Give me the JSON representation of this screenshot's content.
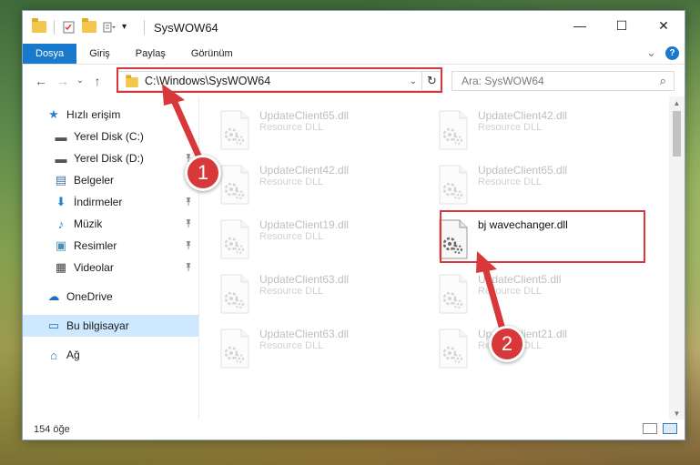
{
  "window": {
    "title": "SysWOW64",
    "controls": {
      "minimize": "—",
      "maximize": "☐",
      "close": "✕"
    }
  },
  "ribbon": {
    "tabs": [
      {
        "label": "Dosya",
        "active": true
      },
      {
        "label": "Giriş"
      },
      {
        "label": "Paylaş"
      },
      {
        "label": "Görünüm"
      }
    ],
    "expand": "⌄",
    "help": "?"
  },
  "navigation": {
    "back": "←",
    "forward": "→",
    "recent": "⌄",
    "up": "↑",
    "address": "C:\\Windows\\SysWOW64",
    "address_dropdown": "⌄",
    "refresh": "↻",
    "search_placeholder": "Ara: SysWOW64"
  },
  "sidebar": {
    "items": [
      {
        "label": "Hızlı erişim",
        "icon": "star-icon",
        "glyph": "★",
        "color": "#2a7fd4",
        "pinned": false
      },
      {
        "label": "Yerel Disk (C:)",
        "icon": "drive-icon",
        "glyph": "▬",
        "color": "#555555",
        "pinned": true
      },
      {
        "label": "Yerel Disk (D:)",
        "icon": "drive-icon",
        "glyph": "▬",
        "color": "#555555",
        "pinned": true
      },
      {
        "label": "Belgeler",
        "icon": "documents-icon",
        "glyph": "▤",
        "color": "#4a6fa5",
        "pinned": true
      },
      {
        "label": "İndirmeler",
        "icon": "downloads-icon",
        "glyph": "⬇",
        "color": "#2a7fd4",
        "pinned": true
      },
      {
        "label": "Müzik",
        "icon": "music-icon",
        "glyph": "♪",
        "color": "#2a7fd4",
        "pinned": true
      },
      {
        "label": "Resimler",
        "icon": "pictures-icon",
        "glyph": "▣",
        "color": "#4a8fb5",
        "pinned": true
      },
      {
        "label": "Videolar",
        "icon": "videos-icon",
        "glyph": "▦",
        "color": "#444444",
        "pinned": true
      },
      {
        "label": "OneDrive",
        "icon": "cloud-icon",
        "glyph": "☁",
        "color": "#1a6fc2",
        "pinned": false
      },
      {
        "label": "Bu bilgisayar",
        "icon": "computer-icon",
        "glyph": "▭",
        "color": "#2a6fb0",
        "pinned": false
      },
      {
        "label": "Ağ",
        "icon": "network-icon",
        "glyph": "⌂",
        "color": "#2a6fb0",
        "pinned": false
      }
    ],
    "pin_glyph": "📌"
  },
  "files": [
    {
      "name": "UpdateClient65.dll",
      "type": "Resource DLL"
    },
    {
      "name": "UpdateClient42.dll",
      "type": "Resource DLL"
    },
    {
      "name": "UpdateClient42.dll",
      "type": "Resource DLL"
    },
    {
      "name": "UpdateClient65.dll",
      "type": "Resource DLL"
    },
    {
      "name": "UpdateClient19.dll",
      "type": "Resource DLL"
    },
    {
      "name": "bj wavechanger.dll",
      "type": ""
    },
    {
      "name": "UpdateClient63.dll",
      "type": "Resource DLL"
    },
    {
      "name": "UpdateClient5.dll",
      "type": "Resource DLL"
    },
    {
      "name": "UpdateClient63.dll",
      "type": "Resource DLL"
    },
    {
      "name": "UpdateClient21.dll",
      "type": "Resource DLL"
    }
  ],
  "status": {
    "count": "154 öğe"
  },
  "annotations": {
    "badge1": "1",
    "badge2": "2",
    "color": "#d9383a"
  }
}
